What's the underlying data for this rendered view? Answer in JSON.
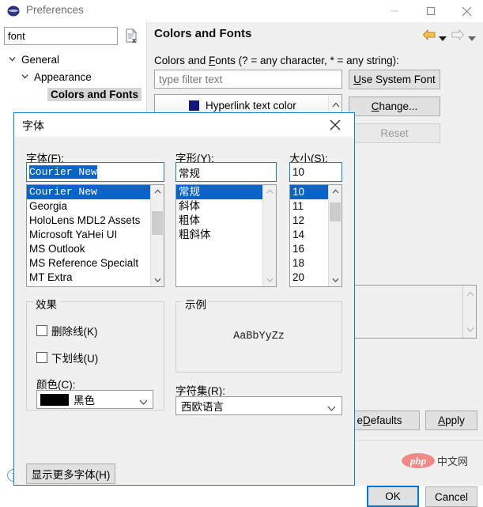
{
  "prefs": {
    "title": "Preferences",
    "filter_value": "font",
    "filter_placeholder": "type filter text",
    "tree": [
      {
        "label": "General",
        "expanded": true
      },
      {
        "label": "Appearance",
        "expanded": true
      },
      {
        "label": "Colors and Fonts",
        "selected": true
      }
    ],
    "page": {
      "title": "Colors and Fonts",
      "description_pre": "Colors and ",
      "description_accel": "F",
      "description_post": "onts (? = any character, * = any string):",
      "tree_filter_placeholder": "type filter text",
      "tree_rows": [
        {
          "label": "Hyperlink text color",
          "swatch": "#15157e"
        }
      ],
      "buttons": {
        "use_system_font_pre": "",
        "use_system_font_accel": "U",
        "use_system_font_post": "se System Font",
        "change_accel": "C",
        "change_post": "hange...",
        "reset": "Reset",
        "restore_defaults_pre": "e ",
        "restore_defaults_accel": "D",
        "restore_defaults_post": "efaults",
        "apply_pre": "",
        "apply_accel": "A",
        "apply_post": "pply",
        "ok": "OK",
        "cancel": "Cancel"
      }
    }
  },
  "font_dialog": {
    "title": "字体",
    "labels": {
      "font": "字体(F):",
      "style": "字形(Y):",
      "size": "大小(S):",
      "effects": "效果",
      "strikeout": "删除线(K)",
      "underline": "下划线(U)",
      "color": "颜色(C):",
      "sample": "示例",
      "script": "字符集(R):"
    },
    "inputs": {
      "font": "Courier New",
      "style": "常规",
      "size": "10"
    },
    "font_list": [
      {
        "label": "Courier New",
        "selected": true,
        "mono": true
      },
      {
        "label": "Georgia",
        "selected": false,
        "mono": false
      },
      {
        "label": "HoloLens MDL2 Assets",
        "selected": false,
        "mono": false
      },
      {
        "label": "Microsoft YaHei UI",
        "selected": false,
        "mono": false
      },
      {
        "label": "MS Outlook",
        "selected": false,
        "mono": false
      },
      {
        "label": "MS Reference Specialt",
        "selected": false,
        "mono": false
      },
      {
        "label": "MT Extra",
        "selected": false,
        "mono": false
      }
    ],
    "style_list": [
      {
        "label": "常规",
        "selected": true
      },
      {
        "label": "斜体",
        "selected": false
      },
      {
        "label": "粗体",
        "selected": false
      },
      {
        "label": "粗斜体",
        "selected": false
      }
    ],
    "size_list": [
      {
        "label": "10",
        "selected": true
      },
      {
        "label": "11",
        "selected": false
      },
      {
        "label": "12",
        "selected": false
      },
      {
        "label": "14",
        "selected": false
      },
      {
        "label": "16",
        "selected": false
      },
      {
        "label": "18",
        "selected": false
      },
      {
        "label": "20",
        "selected": false
      }
    ],
    "effects": {
      "strikeout_checked": false,
      "underline_checked": false,
      "color_value": "黑色",
      "color_hex": "#000000"
    },
    "sample_text": "AaBbYyZz",
    "script_value": "西欧语言",
    "show_more_fonts": "显示更多字体(H)"
  },
  "watermark": {
    "logo": "php",
    "text": "中文网"
  },
  "colors": {
    "accent": "#0a64c8",
    "dialog_border": "#1a7dc4",
    "panel_bg": "#f0f0f0",
    "button_bg": "#e1e1e1",
    "ok_border": "#0078d7"
  }
}
